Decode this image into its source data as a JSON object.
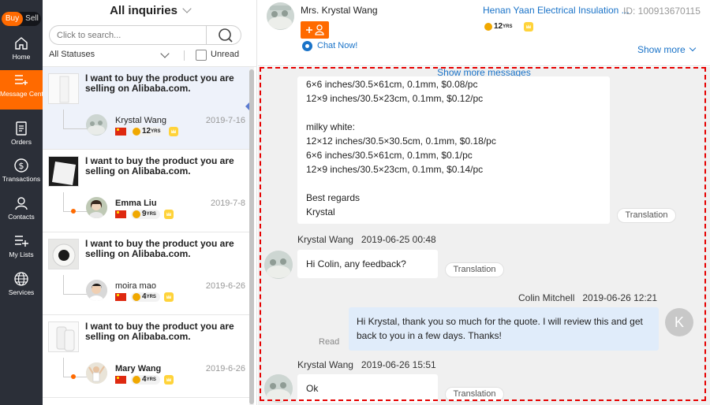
{
  "nav": {
    "buy_label": "Buy",
    "sell_label": "Sell",
    "items": [
      {
        "label": "Home",
        "icon": "home-icon"
      },
      {
        "label": "Message Center",
        "icon": "message-list-icon"
      },
      {
        "label": "Orders",
        "icon": "orders-icon"
      },
      {
        "label": "Transactions",
        "icon": "dollar-icon"
      },
      {
        "label": "Contacts",
        "icon": "contacts-icon"
      },
      {
        "label": "My Lists",
        "icon": "list-add-icon"
      },
      {
        "label": "Services",
        "icon": "globe-icon"
      }
    ],
    "accent_color": "#ff6a00",
    "bg_color": "#2b2f38"
  },
  "inquiries": {
    "title": "All inquiries",
    "search_placeholder": "Click to search...",
    "status_filter": "All Statuses",
    "unread_label": "Unread",
    "items": [
      {
        "subject": "I want to buy the product you are selling on Alibaba.com.",
        "name": "Krystal Wang",
        "date": "2019-7-16",
        "years": "12",
        "years_unit": "YRS"
      },
      {
        "subject": "I want to buy the product you are selling on Alibaba.com.",
        "name": "Emma Liu",
        "date": "2019-7-8",
        "years": "9",
        "years_unit": "YRS"
      },
      {
        "subject": "I want to buy the product you are selling on Alibaba.com.",
        "name": "moira mao",
        "date": "2019-6-26",
        "years": "4",
        "years_unit": "YRS"
      },
      {
        "subject": "I want to buy the product you are selling on Alibaba.com.",
        "name": "Mary Wang",
        "date": "2019-6-26",
        "years": "4",
        "years_unit": "YRS"
      }
    ]
  },
  "conversation": {
    "buyer_name": "Mrs. Krystal Wang",
    "company": "Henan Yaan Electrical Insulation ...",
    "buyer_id": "ID: 100913670115",
    "years": "12",
    "years_unit": "YRS",
    "chat_now": "Chat Now!",
    "show_more": "Show more",
    "show_more_messages": "Show more messages",
    "translation_label": "Translation",
    "messages": [
      {
        "lines": [
          "6×6 inches/30.5×61cm, 0.1mm, $0.08/pc",
          "12×9 inches/30.5×23cm, 0.1mm, $0.12/pc",
          "",
          "milky white:",
          "12×12 inches/30.5×30.5cm, 0.1mm, $0.18/pc",
          "6×6 inches/30.5×61cm, 0.1mm, $0.1/pc",
          "12×9 inches/30.5×23cm, 0.1mm, $0.14/pc",
          "",
          "Best regards",
          "Krystal"
        ]
      },
      {
        "sender": "Krystal Wang",
        "time": "2019-06-25 00:48",
        "text": "Hi Colin, any feedback?"
      },
      {
        "sender": "Colin Mitchell",
        "time": "2019-06-26 12:21",
        "text": "Hi Krystal, thank you so much for the quote. I will review this and get back to you in a few days. Thanks!",
        "status": "Read",
        "avatar_letter": "K"
      },
      {
        "sender": "Krystal Wang",
        "time": "2019-06-26 15:51",
        "text": "Ok"
      }
    ]
  },
  "colors": {
    "link": "#1a73c8",
    "accent": "#ff6a00",
    "highlight_frame": "#e60000",
    "outgoing_bubble": "#e0ecfa"
  }
}
